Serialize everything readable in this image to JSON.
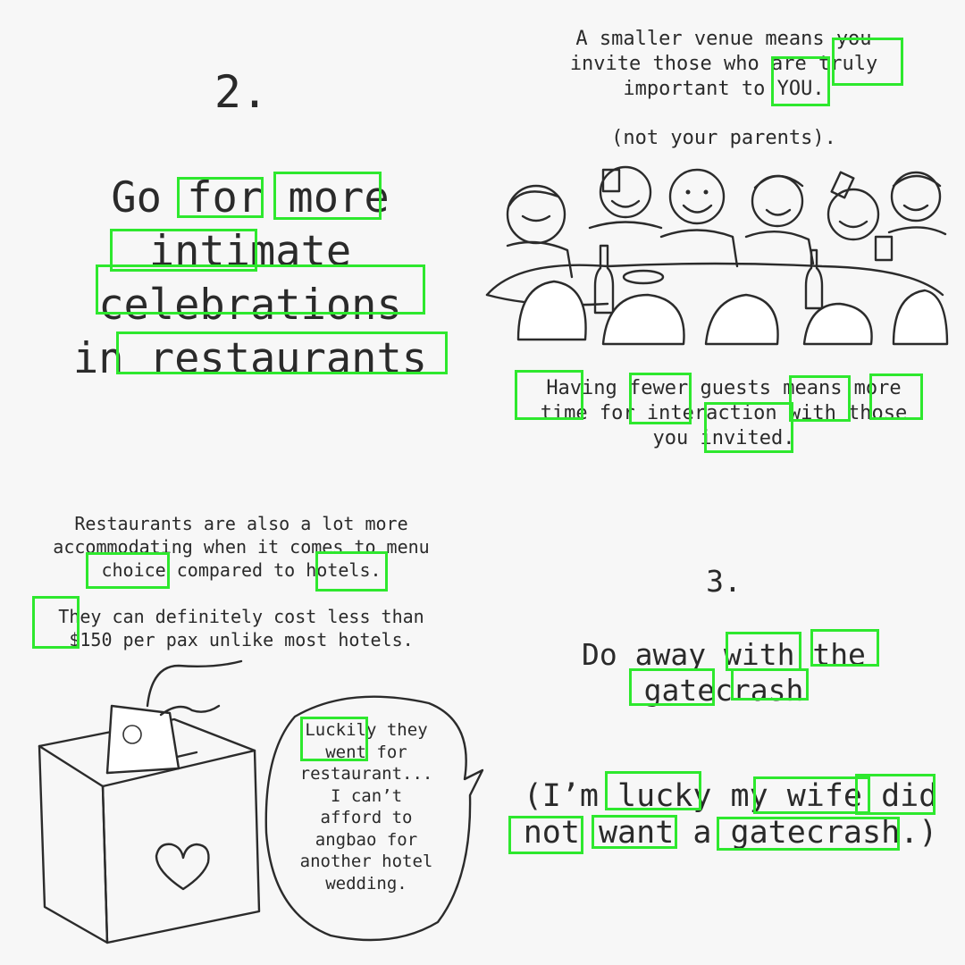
{
  "panel1": {
    "number": "2.",
    "headline_lines": [
      "Go for more",
      "intimate",
      "celebrations",
      "in restaurants"
    ]
  },
  "panel2": {
    "top_text": "A smaller venue means you\ninvite those who are truly\nimportant to YOU.",
    "parenthetical": "(not your parents).",
    "bottom_text": "Having fewer guests means more\ntime for interaction with those\nyou invited."
  },
  "panel3": {
    "text_a": "Restaurants are also a lot more\naccommodating when it comes to menu\nchoice compared to hotels.",
    "text_b": "They can definitely cost less than\n$150 per pax unlike most hotels.",
    "speech_bubble": "Luckily they\nwent for\nrestaurant...\nI can’t\nafford to\nangbao for\nanother hotel\nwedding."
  },
  "panel4": {
    "number": "3.",
    "headline": "Do away with the\ngatecrash",
    "subtext": "(I’m lucky my wife did\nnot want a gatecrash.)"
  },
  "highlight_color": "#2ee82e",
  "icons": [
    "party-table-illustration",
    "donation-box-illustration",
    "heart-icon",
    "speech-bubble"
  ]
}
